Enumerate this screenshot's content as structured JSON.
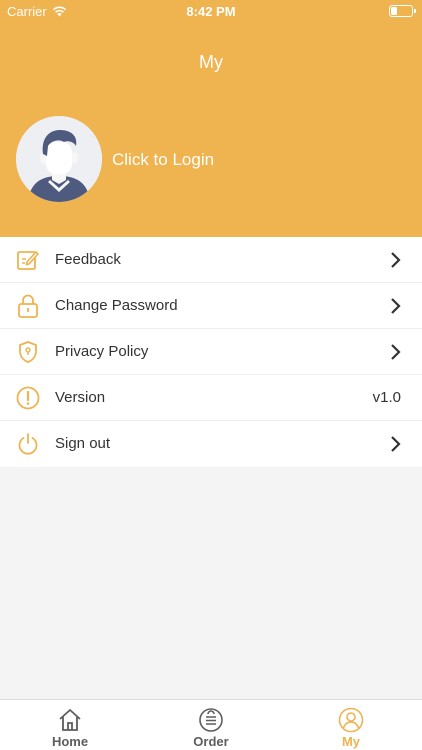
{
  "status_bar": {
    "carrier": "Carrier",
    "time": "8:42 PM"
  },
  "header": {
    "title": "My",
    "login_text": "Click to Login"
  },
  "menu": [
    {
      "label": "Feedback",
      "icon": "feedback-icon",
      "value": ""
    },
    {
      "label": "Change Password",
      "icon": "lock-icon",
      "value": ""
    },
    {
      "label": "Privacy Policy",
      "icon": "shield-icon",
      "value": ""
    },
    {
      "label": "Version",
      "icon": "exclamation-icon",
      "value": "v1.0"
    },
    {
      "label": "Sign out",
      "icon": "power-icon",
      "value": ""
    }
  ],
  "tabbar": [
    {
      "label": "Home",
      "icon": "home-icon"
    },
    {
      "label": "Order",
      "icon": "order-icon"
    },
    {
      "label": "My",
      "icon": "user-icon",
      "active": true
    }
  ],
  "colors": {
    "accent": "#efb34f",
    "background": "#f4f4f4",
    "text": "#333333",
    "tab_inactive": "#5d5d5d"
  }
}
